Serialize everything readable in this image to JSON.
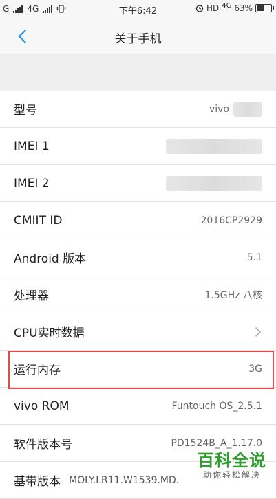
{
  "status_bar": {
    "carrier_left": "G",
    "network_2": "4G",
    "time": "下午6:42",
    "hd": "HD",
    "net_type": "4G",
    "battery_percent": "63%",
    "battery_level": 0.63
  },
  "nav": {
    "title": "关于手机"
  },
  "rows": [
    {
      "label": "型号",
      "value": "vivo"
    },
    {
      "label": "IMEI 1",
      "value": ""
    },
    {
      "label": "IMEI 2",
      "value": ""
    },
    {
      "label": "CMIIT ID",
      "value": "2016CP2929"
    },
    {
      "label": "Android 版本",
      "value": "5.1"
    },
    {
      "label": "处理器",
      "value": "1.5GHz 八核"
    },
    {
      "label": "CPU实时数据",
      "value": ""
    },
    {
      "label": "运行内存",
      "value": "3G"
    },
    {
      "label": "vivo ROM",
      "value": "Funtouch OS_2.5.1"
    },
    {
      "label": "软件版本号",
      "value": "PD1524B_A_1.17.0"
    },
    {
      "label": "基带版本",
      "value": "MOLY.LR11.W1539.MD."
    }
  ],
  "watermark": {
    "main": "百科全说",
    "sub": "助你轻松解决"
  },
  "colors": {
    "highlight": "#e34b4b",
    "accent": "#2196f3",
    "watermark": "#2f9e2f"
  }
}
